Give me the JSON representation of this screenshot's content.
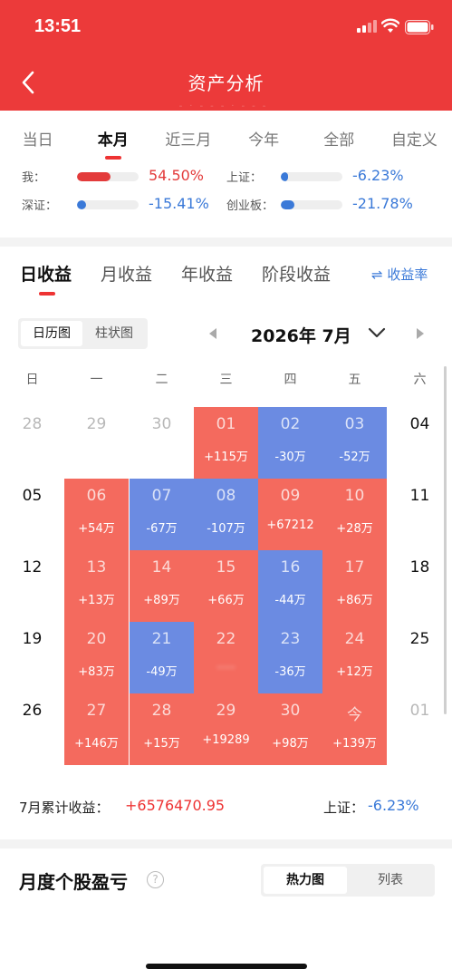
{
  "status_bar": {
    "time": "13:51"
  },
  "header": {
    "title": "资产分析",
    "hidden_amount": "-·---·---"
  },
  "range_tabs": [
    {
      "label": "当日",
      "active": false
    },
    {
      "label": "本月",
      "active": true
    },
    {
      "label": "近三月",
      "active": false
    },
    {
      "label": "今年",
      "active": false
    },
    {
      "label": "全部",
      "active": false
    },
    {
      "label": "自定义",
      "active": false
    }
  ],
  "comparison": [
    {
      "label": "我：",
      "value": "54.50%",
      "fill": 0.545,
      "color": "#e33b3b"
    },
    {
      "label": "上证：",
      "value": "-6.23%",
      "fill": 0.0623,
      "color": "#3a79d8"
    },
    {
      "label": "深证：",
      "value": "-15.41%",
      "fill": 0.1541,
      "color": "#3a79d8"
    },
    {
      "label": "创业板：",
      "value": "-21.78%",
      "fill": 0.2178,
      "color": "#3a79d8"
    }
  ],
  "sub_tabs": [
    {
      "label": "日收益",
      "active": true
    },
    {
      "label": "月收益",
      "active": false
    },
    {
      "label": "年收益",
      "active": false
    },
    {
      "label": "阶段收益",
      "active": false
    }
  ],
  "yield_toggle": "⇌ 收益率",
  "view_toggle": {
    "calendar": "日历图",
    "bar": "柱状图",
    "active": "calendar"
  },
  "month_label": "2026年 7月",
  "weekdays": [
    "日",
    "一",
    "二",
    "三",
    "四",
    "五",
    "六"
  ],
  "calendar": [
    [
      {
        "day": "28",
        "type": "muted",
        "value": ""
      },
      {
        "day": "29",
        "type": "muted",
        "value": ""
      },
      {
        "day": "30",
        "type": "muted",
        "value": ""
      },
      {
        "day": "01",
        "type": "gain",
        "value": "+115万"
      },
      {
        "day": "02",
        "type": "loss",
        "value": "-30万"
      },
      {
        "day": "03",
        "type": "loss",
        "value": "-52万"
      },
      {
        "day": "04",
        "type": "plain",
        "value": ""
      }
    ],
    [
      {
        "day": "05",
        "type": "plain",
        "value": ""
      },
      {
        "day": "06",
        "type": "gain",
        "value": "+54万"
      },
      {
        "day": "07",
        "type": "loss",
        "value": "-67万"
      },
      {
        "day": "08",
        "type": "loss",
        "value": "-107万"
      },
      {
        "day": "09",
        "type": "gain",
        "value": "+67212"
      },
      {
        "day": "10",
        "type": "gain",
        "value": "+28万"
      },
      {
        "day": "11",
        "type": "plain",
        "value": ""
      }
    ],
    [
      {
        "day": "12",
        "type": "plain",
        "value": ""
      },
      {
        "day": "13",
        "type": "gain",
        "value": "+13万"
      },
      {
        "day": "14",
        "type": "gain",
        "value": "+89万"
      },
      {
        "day": "15",
        "type": "gain",
        "value": "+66万"
      },
      {
        "day": "16",
        "type": "loss",
        "value": "-44万"
      },
      {
        "day": "17",
        "type": "gain",
        "value": "+86万"
      },
      {
        "day": "18",
        "type": "plain",
        "value": ""
      }
    ],
    [
      {
        "day": "19",
        "type": "plain",
        "value": ""
      },
      {
        "day": "20",
        "type": "gain",
        "value": "+83万"
      },
      {
        "day": "21",
        "type": "loss",
        "value": "-49万"
      },
      {
        "day": "22",
        "type": "gain",
        "value": "·····",
        "blur": true
      },
      {
        "day": "23",
        "type": "loss",
        "value": "-36万"
      },
      {
        "day": "24",
        "type": "gain",
        "value": "+12万"
      },
      {
        "day": "25",
        "type": "plain",
        "value": ""
      }
    ],
    [
      {
        "day": "26",
        "type": "plain",
        "value": ""
      },
      {
        "day": "27",
        "type": "gain",
        "value": "+146万"
      },
      {
        "day": "28",
        "type": "gain",
        "value": "+15万"
      },
      {
        "day": "29",
        "type": "gain",
        "value": "+19289"
      },
      {
        "day": "30",
        "type": "gain",
        "value": "+98万"
      },
      {
        "day": "今",
        "type": "gain",
        "value": "+139万"
      },
      {
        "day": "01",
        "type": "muted",
        "value": ""
      }
    ]
  ],
  "summary": {
    "label": "7月累计收益：",
    "value": "+6576470.95",
    "index_label": "上证：",
    "index_value": "-6.23%"
  },
  "monthly_section": {
    "title": "月度个股盈亏",
    "help": "?",
    "toggle": {
      "heatmap": "热力图",
      "list": "列表",
      "active": "heatmap"
    }
  },
  "colors": {
    "brand_red": "#ec3a3a",
    "gain": "#f46a5e",
    "loss": "#6b8be2",
    "blue_text": "#3a79d8"
  }
}
